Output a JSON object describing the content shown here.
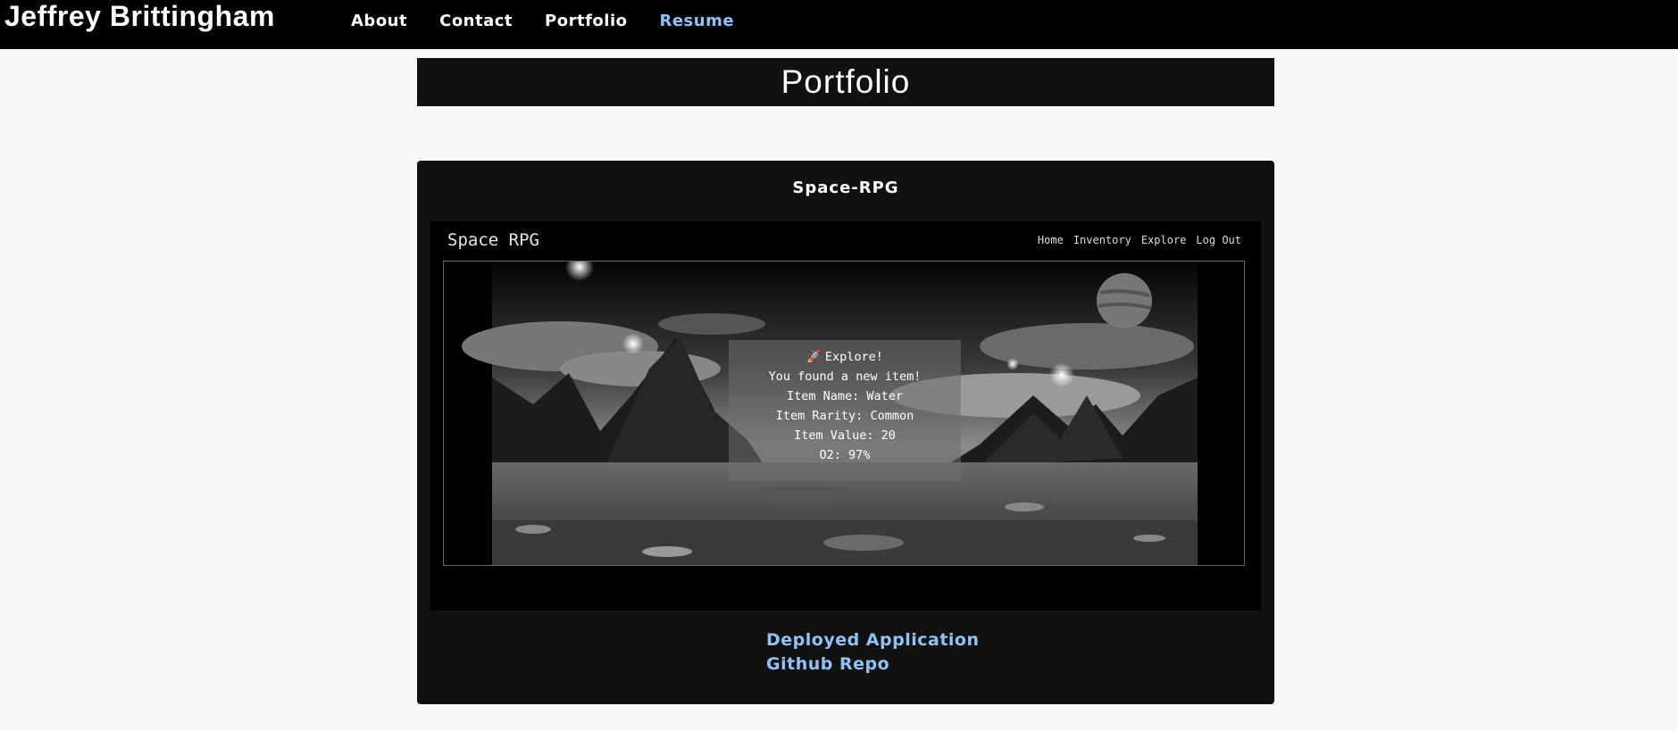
{
  "header": {
    "brand": "Jeffrey Brittingham",
    "nav": [
      {
        "label": "About"
      },
      {
        "label": "Contact"
      },
      {
        "label": "Portfolio"
      },
      {
        "label": "Resume"
      }
    ],
    "active_color": "#8ec3f7"
  },
  "page": {
    "title": "Portfolio"
  },
  "project": {
    "title": "Space-RPG",
    "screenshot": {
      "app_title": "Space RPG",
      "nav": [
        "Home",
        "Inventory",
        "Explore",
        "Log Out"
      ],
      "explore": {
        "heading": "Explore!",
        "lines": [
          "You found a new item!",
          "Item Name: Water",
          "Item Rarity: Common",
          "Item Value: 20",
          "O2: 97%"
        ]
      }
    },
    "links": {
      "deployed": "Deployed Application",
      "repo": "Github Repo"
    }
  }
}
